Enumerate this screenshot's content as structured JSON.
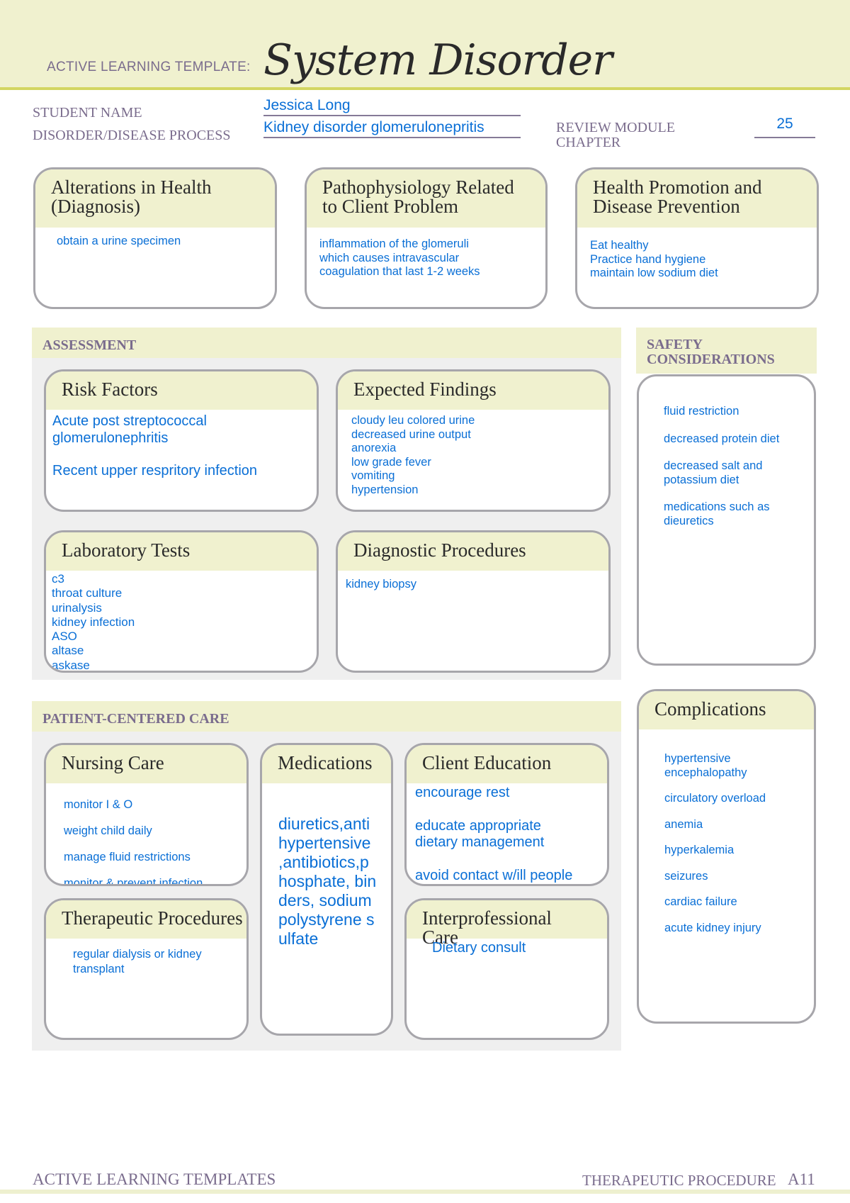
{
  "header": {
    "template_label": "ACTIVE LEARNING TEMPLATE:",
    "title": "System Disorder"
  },
  "fields": {
    "student_name_label": "STUDENT NAME",
    "student_name": "Jessica Long",
    "disorder_label": "DISORDER/DISEASE PROCESS",
    "disorder": "Kidney disorder glomerulonepritis",
    "review_module_label": "REVIEW MODULE CHAPTER",
    "review_module": "25"
  },
  "top_boxes": [
    {
      "title": "Alterations in Health (Diagnosis)",
      "items": [
        "obtain a urine specimen"
      ]
    },
    {
      "title": "Pathophysiology Related to Client Problem",
      "items": [
        "inflammation of the glomeruli",
        "which causes intravascular",
        "coagulation that last 1-2 weeks"
      ]
    },
    {
      "title": "Health Promotion and Disease Prevention",
      "items": [
        "Eat healthy",
        "Practice hand hygiene",
        "maintain low sodium diet"
      ]
    }
  ],
  "assessment": {
    "label": "ASSESSMENT",
    "risk_factors": {
      "title": "Risk Factors",
      "items": [
        "Acute post streptococcal glomerulonephritis",
        "Recent upper respritory infection"
      ]
    },
    "expected_findings": {
      "title": "Expected Findings",
      "items": [
        "cloudy leu colored urine",
        "decreased urine output",
        "anorexia",
        "low grade fever",
        "vomiting",
        "hypertension"
      ]
    },
    "lab_tests": {
      "title": "Laboratory Tests",
      "items": [
        "c3",
        "throat culture",
        "urinalysis",
        "kidney infection",
        "ASO",
        "altase",
        "askase"
      ]
    },
    "diagnostic_procedures": {
      "title": "Diagnostic Procedures",
      "items": [
        "kidney biopsy"
      ]
    }
  },
  "safety": {
    "label": "SAFETY CONSIDERATIONS",
    "items": [
      "fluid restriction",
      "decreased protein diet",
      "decreased salt and potassium diet",
      "medications such as dieuretics"
    ]
  },
  "patient_care": {
    "label": "PATIENT-CENTERED CARE",
    "nursing_care": {
      "title": "Nursing Care",
      "items": [
        "monitor I & O",
        "weight child daily",
        "manage fluid restrictions",
        "monitor & prevent infection"
      ]
    },
    "medications": {
      "title": "Medications",
      "text": "diuretics,anti hypertensive ,antibiotics,p hosphate, binders, sodium polystyrene sulfate"
    },
    "client_education": {
      "title": "Client Education",
      "items": [
        "encourage rest",
        "educate appropriate dietary management",
        "avoid contact w/ill people"
      ]
    },
    "therapeutic_procedures": {
      "title": "Therapeutic Procedures",
      "items": [
        "regular dialysis or kidney transplant"
      ]
    },
    "interprofessional_care": {
      "title": "Interprofessional Care",
      "items": [
        "Dietary consult"
      ]
    }
  },
  "complications": {
    "title": "Complications",
    "items": [
      "hypertensive encephalopathy",
      "circulatory overload",
      "anemia",
      "hyperkalemia",
      "seizures",
      "cardiac failure",
      "acute kidney injury"
    ]
  },
  "footer": {
    "left": "ACTIVE LEARNING TEMPLATES",
    "right": "THERAPEUTIC PROCEDURE",
    "page": "A11"
  },
  "colors": {
    "accent_bg": "#f0f1cf",
    "label": "#7a6c8d",
    "entry_text": "#0a6fd6",
    "border": "#a7a6ab"
  }
}
